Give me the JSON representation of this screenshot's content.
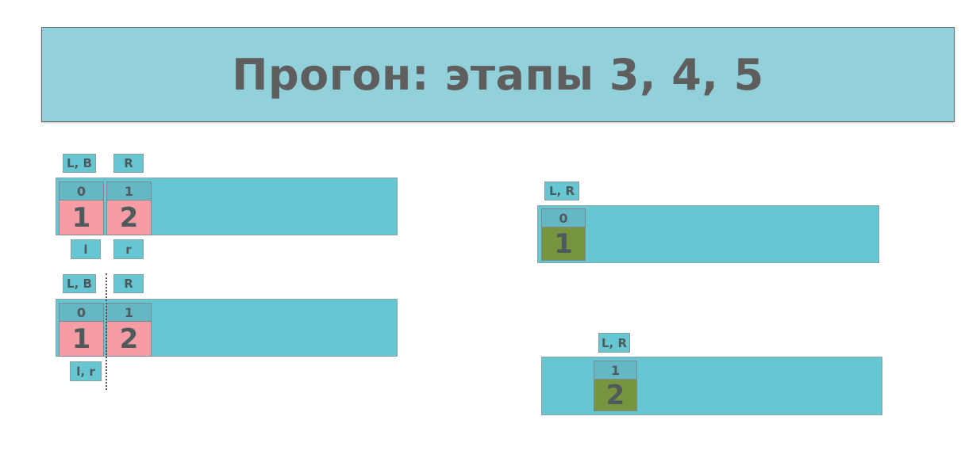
{
  "title": "Прогон: этапы 3, 4, 5",
  "colors": {
    "title_bg": "#92d1da",
    "strip": "#66c6d2",
    "index_cell": "#66b7c4",
    "pink_cell": "#f69ca5",
    "green_cell": "#77953e"
  },
  "panel_a": {
    "top_ptr_1": "L, B",
    "top_ptr_2": "R",
    "cells": [
      {
        "index": "0",
        "value": "1"
      },
      {
        "index": "1",
        "value": "2"
      }
    ],
    "bottom_ptr_1": "l",
    "bottom_ptr_2": "r"
  },
  "panel_b": {
    "top_ptr_1": "L, B",
    "top_ptr_2": "R",
    "cells": [
      {
        "index": "0",
        "value": "1"
      },
      {
        "index": "1",
        "value": "2"
      }
    ],
    "bottom_ptr_1": "l, r"
  },
  "panel_c": {
    "top_ptr": "L, R",
    "cells": [
      {
        "index": "0",
        "value": "1"
      }
    ]
  },
  "panel_d": {
    "top_ptr": "L, R",
    "cells": [
      {
        "index": "1",
        "value": "2"
      }
    ]
  }
}
